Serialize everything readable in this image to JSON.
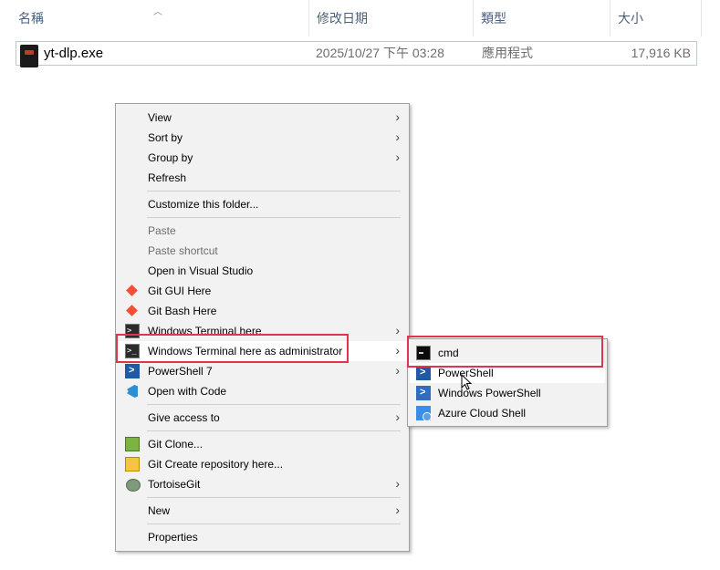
{
  "columns": {
    "name": "名稱",
    "date": "修改日期",
    "type": "類型",
    "size": "大小"
  },
  "file": {
    "name": "yt-dlp.exe",
    "modified": "2025/10/27 下午 03:28",
    "type": "應用程式",
    "size": "17,916 KB"
  },
  "context_menu": {
    "items": [
      {
        "label": "View"
      },
      {
        "label": "Sort by"
      },
      {
        "label": "Group by"
      },
      {
        "label": "Refresh"
      },
      {
        "label": "Customize this folder..."
      },
      {
        "label": "Paste"
      },
      {
        "label": "Paste shortcut"
      },
      {
        "label": "Open in Visual Studio"
      },
      {
        "label": "Git GUI Here"
      },
      {
        "label": "Git Bash Here"
      },
      {
        "label": "Windows Terminal here"
      },
      {
        "label": "Windows Terminal here as administrator"
      },
      {
        "label": "PowerShell 7"
      },
      {
        "label": "Open with Code"
      },
      {
        "label": "Give access to"
      },
      {
        "label": "Git Clone..."
      },
      {
        "label": "Git Create repository here..."
      },
      {
        "label": "TortoiseGit"
      },
      {
        "label": "New"
      },
      {
        "label": "Properties"
      }
    ]
  },
  "submenu": {
    "items": [
      {
        "label": "cmd",
        "icon": "cmd-icon"
      },
      {
        "label": "PowerShell",
        "icon": "powershell-icon"
      },
      {
        "label": "Windows PowerShell",
        "icon": "windows-powershell-icon"
      },
      {
        "label": "Azure Cloud Shell",
        "icon": "azure-cloud-shell-icon"
      }
    ]
  },
  "colors": {
    "highlight_box": "#e0354b",
    "selection_border": "#99d1ff",
    "menu_bg": "#f2f2f2"
  }
}
